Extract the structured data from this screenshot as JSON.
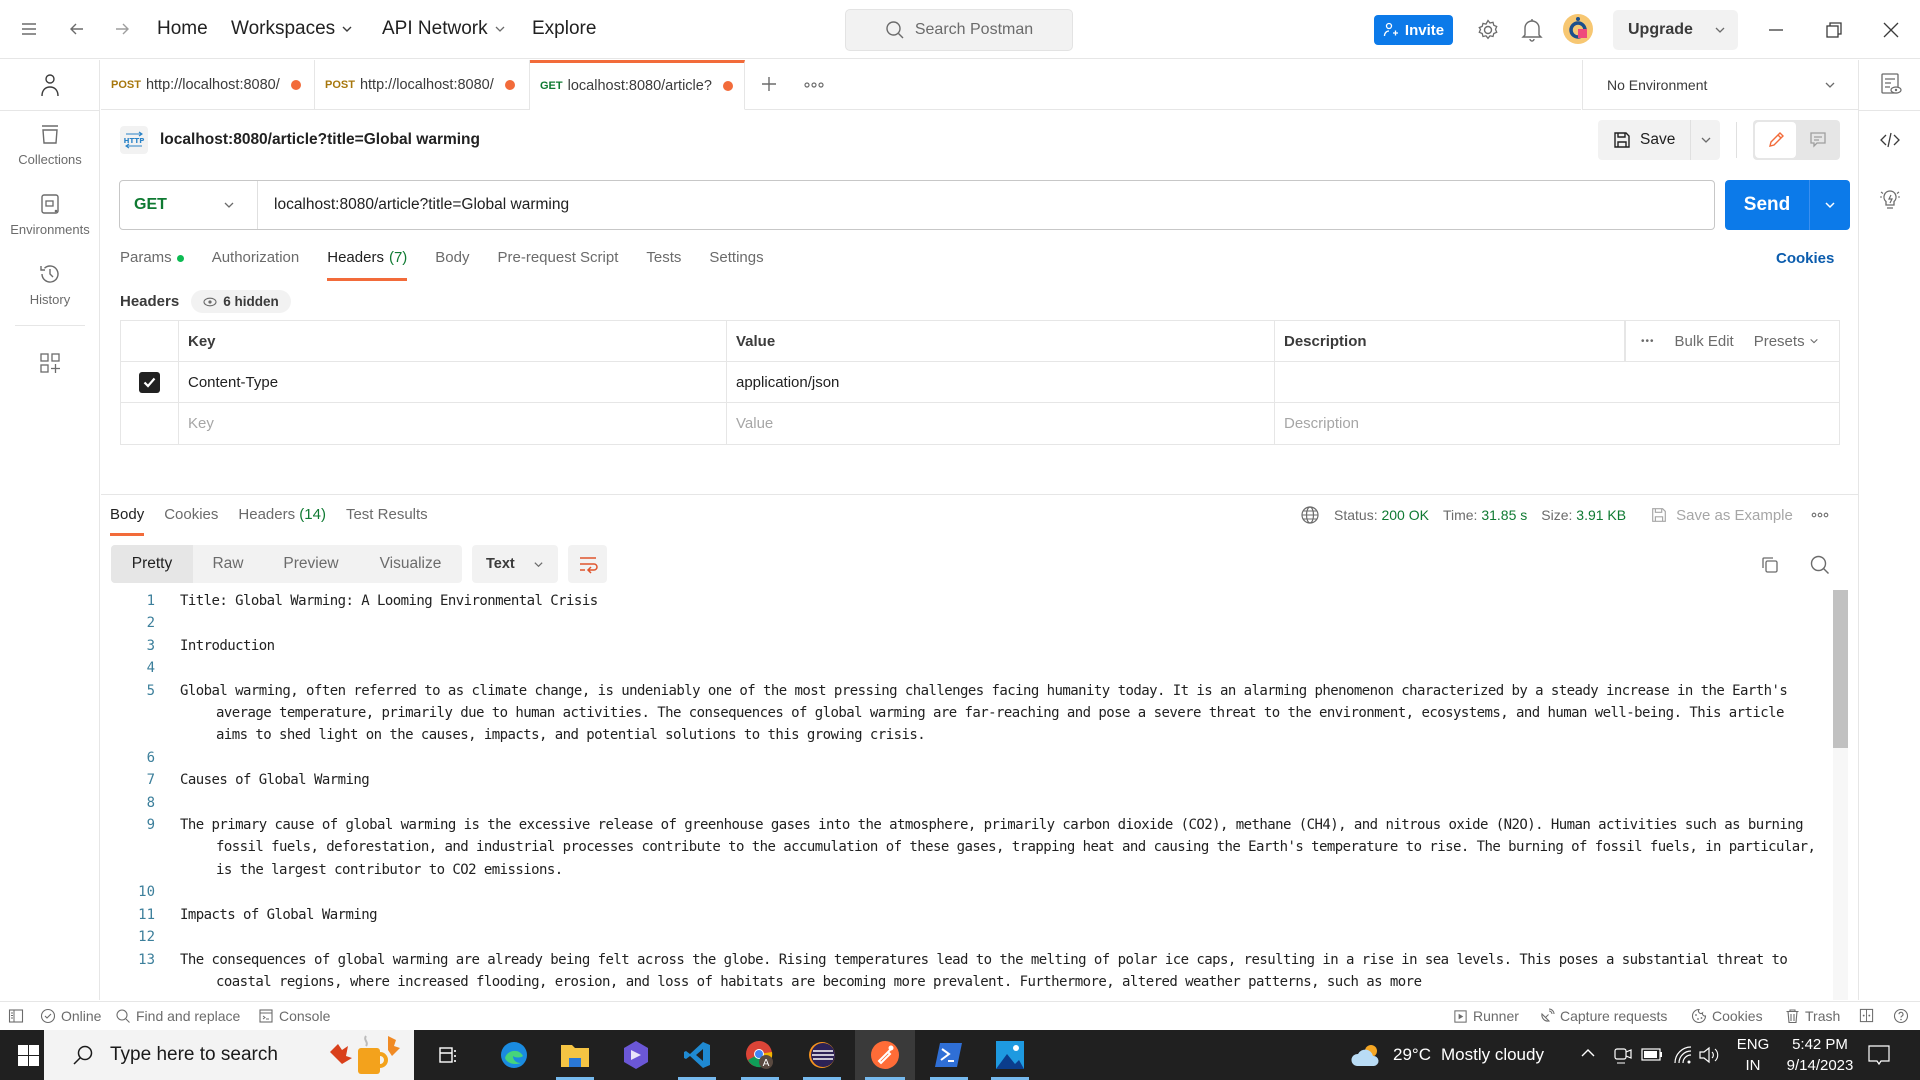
{
  "topbar": {
    "nav": [
      {
        "label": "Home",
        "has_menu": false
      },
      {
        "label": "Workspaces",
        "has_menu": true
      },
      {
        "label": "API Network",
        "has_menu": true
      },
      {
        "label": "Explore",
        "has_menu": false
      }
    ],
    "search_placeholder": "Search Postman",
    "invite_label": "Invite",
    "upgrade_label": "Upgrade"
  },
  "sidebar": {
    "items": [
      {
        "label": "Collections",
        "icon": "collections-icon"
      },
      {
        "label": "Environments",
        "icon": "environments-icon"
      },
      {
        "label": "History",
        "icon": "history-icon"
      }
    ]
  },
  "request_tabs": [
    {
      "method": "POST",
      "label": "http://localhost:8080/",
      "method_color": "#a7770d",
      "unsaved": true,
      "active": false
    },
    {
      "method": "POST",
      "label": "http://localhost:8080/",
      "method_color": "#a7770d",
      "unsaved": true,
      "active": false
    },
    {
      "method": "GET",
      "label": "localhost:8080/article?",
      "method_color": "#0f7a32",
      "unsaved": true,
      "active": true
    }
  ],
  "environment": {
    "selected": "No Environment"
  },
  "request": {
    "title": "localhost:8080/article?title=Global warming",
    "save_label": "Save",
    "method": "GET",
    "url": "localhost:8080/article?title=Global warming",
    "send_label": "Send",
    "tabs": [
      {
        "label": "Params",
        "indicator_dot": true,
        "active": false
      },
      {
        "label": "Authorization",
        "active": false
      },
      {
        "label": "Headers",
        "count": "(7)",
        "active": true
      },
      {
        "label": "Body",
        "active": false
      },
      {
        "label": "Pre-request Script",
        "active": false
      },
      {
        "label": "Tests",
        "active": false
      },
      {
        "label": "Settings",
        "active": false
      }
    ],
    "cookies_link": "Cookies",
    "headers_label": "Headers",
    "hidden_count_label": "6 hidden",
    "headers_table": {
      "columns": [
        "Key",
        "Value",
        "Description"
      ],
      "actions": {
        "more": "•••",
        "bulk_edit": "Bulk Edit",
        "presets": "Presets"
      },
      "rows": [
        {
          "checked": true,
          "key": "Content-Type",
          "value": "application/json",
          "description": ""
        }
      ],
      "placeholder_row": {
        "key": "Key",
        "value": "Value",
        "description": "Description"
      }
    }
  },
  "response": {
    "tabs": [
      {
        "label": "Body",
        "active": true
      },
      {
        "label": "Cookies",
        "active": false
      },
      {
        "label": "Headers",
        "count": "(14)",
        "active": false
      },
      {
        "label": "Test Results",
        "active": false
      }
    ],
    "status_label": "Status:",
    "status": "200 OK",
    "time_label": "Time:",
    "time": "31.85 s",
    "size_label": "Size:",
    "size": "3.91 KB",
    "save_example_label": "Save as Example",
    "view_modes": [
      "Pretty",
      "Raw",
      "Preview",
      "Visualize"
    ],
    "active_view": "Pretty",
    "format": "Text",
    "lines": [
      {
        "n": "1",
        "text": "Title: Global Warming: A Looming Environmental Crisis"
      },
      {
        "n": "2",
        "text": ""
      },
      {
        "n": "3",
        "text": "Introduction"
      },
      {
        "n": "4",
        "text": ""
      },
      {
        "n": "5",
        "text": "Global warming, often referred to as climate change, is undeniably one of the most pressing challenges facing humanity today. It is an alarming phenomenon characterized by a steady increase in the Earth's average temperature, primarily due to human activities. The consequences of global warming are far-reaching and pose a severe threat to the environment, ecosystems, and human well-being. This article aims to shed light on the causes, impacts, and potential solutions to this growing crisis."
      },
      {
        "n": "6",
        "text": ""
      },
      {
        "n": "7",
        "text": "Causes of Global Warming"
      },
      {
        "n": "8",
        "text": ""
      },
      {
        "n": "9",
        "text": "The primary cause of global warming is the excessive release of greenhouse gases into the atmosphere, primarily carbon dioxide (CO2), methane (CH4), and nitrous oxide (N2O). Human activities such as burning fossil fuels, deforestation, and industrial processes contribute to the accumulation of these gases, trapping heat and causing the Earth's temperature to rise. The burning of fossil fuels, in particular, is the largest contributor to CO2 emissions."
      },
      {
        "n": "10",
        "text": ""
      },
      {
        "n": "11",
        "text": "Impacts of Global Warming"
      },
      {
        "n": "12",
        "text": ""
      },
      {
        "n": "13",
        "text": "The consequences of global warming are already being felt across the globe. Rising temperatures lead to the melting of polar ice caps, resulting in a rise in sea levels. This poses a substantial threat to coastal regions, where increased flooding, erosion, and loss of habitats are becoming more prevalent. Furthermore, altered weather patterns, such as more"
      }
    ]
  },
  "statusbar": {
    "online": "Online",
    "find_replace": "Find and replace",
    "console": "Console",
    "runner": "Runner",
    "capture": "Capture requests",
    "cookies": "Cookies",
    "trash": "Trash"
  },
  "taskbar": {
    "search_placeholder": "Type here to search",
    "weather_temp": "29°C",
    "weather_desc": "Mostly cloudy",
    "lang_top": "ENG",
    "lang_bottom": "IN",
    "time": "5:42 PM",
    "date": "9/14/2023"
  },
  "colors": {
    "accent_orange": "#f26b3a",
    "primary_blue": "#0c7ae9",
    "success_green": "#0f7a32"
  }
}
